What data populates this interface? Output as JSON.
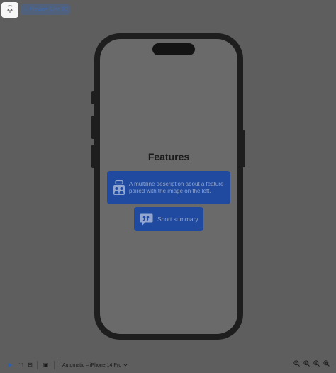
{
  "top_bar": {
    "pin_icon": "pin-icon",
    "preview_label": "Preview (Line 20)",
    "preview_icon": "hand-tap-icon"
  },
  "screen": {
    "title": "Features",
    "feature_card": {
      "icon": "people-group-icon",
      "description": "A multiline description about a feature paired with the image on the left."
    },
    "summary_card": {
      "icon": "quote-bubble-icon",
      "label": "Short summary"
    }
  },
  "toolbar": {
    "mode_buttons": [
      {
        "name": "live-mode",
        "glyph": "▶"
      },
      {
        "name": "selectable-mode",
        "glyph": "⬚"
      },
      {
        "name": "variants-mode",
        "glyph": "⊞"
      }
    ],
    "settings_glyph": "▣",
    "device": {
      "label": "Automatic – iPhone 14 Pro",
      "icon": "phone-icon",
      "chevron": "chevron-down-icon"
    },
    "zoom_buttons": [
      {
        "name": "zoom-out",
        "glyph": "−"
      },
      {
        "name": "zoom-fit",
        "glyph": "⊖"
      },
      {
        "name": "zoom-actual",
        "glyph": "⊕"
      },
      {
        "name": "zoom-in",
        "glyph": "+"
      }
    ]
  },
  "colors": {
    "overlay": "#5e5e5e",
    "card": "#1f4aa0",
    "card_text": "#92a6cf"
  }
}
